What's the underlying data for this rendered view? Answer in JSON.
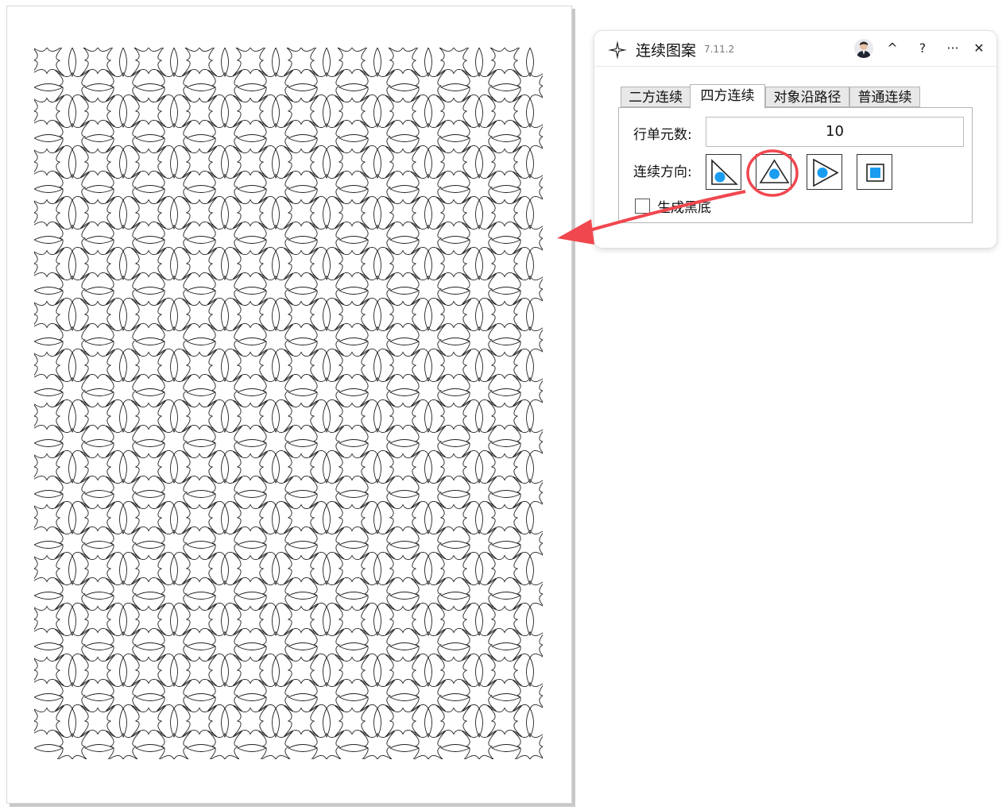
{
  "dialog": {
    "title": "连续图案",
    "version": "7.11.2",
    "icons": {
      "app": "sparkle-icon",
      "avatar": "user-avatar",
      "collapse": "caret-up-icon",
      "help": "question-icon",
      "more": "ellipsis-icon",
      "close": "close-icon"
    },
    "buttons": {
      "collapse": "^",
      "help": "?",
      "more": "···",
      "close": "✕"
    },
    "tabs": [
      {
        "label": "二方连续",
        "active": false
      },
      {
        "label": "四方连续",
        "active": true
      },
      {
        "label": "对象沿路径",
        "active": false
      },
      {
        "label": "普通连续",
        "active": false
      }
    ],
    "row_units_label": "行单元数:",
    "row_units_value": "10",
    "direction_label": "连续方向:",
    "directions": [
      {
        "name": "diagonal-triangle"
      },
      {
        "name": "up-triangle",
        "highlighted": true
      },
      {
        "name": "right-triangle"
      },
      {
        "name": "center-square"
      }
    ],
    "black_bg_label": "生成黑底",
    "black_bg_checked": false
  },
  "colors": {
    "accent_dot": "#1a9cf0",
    "annotation": "#f0474f"
  }
}
